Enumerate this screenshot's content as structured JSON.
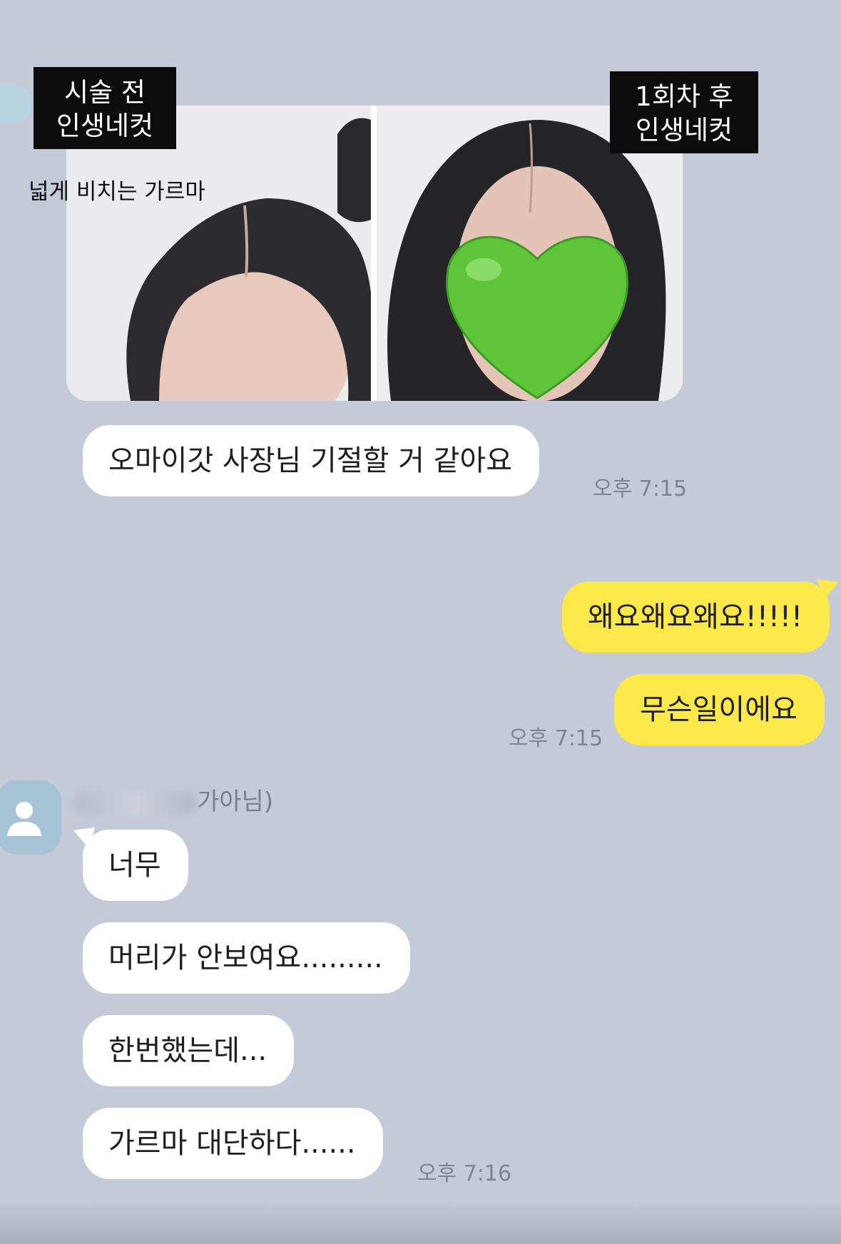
{
  "overlay": {
    "before_caption_line1": "시술 전",
    "before_caption_line2": "인생네컷",
    "after_caption_line1": "1회차 후",
    "after_caption_line2": "인생네컷",
    "parting_label": "넓게 비치는 가르마"
  },
  "photos": {
    "before_icon": "hair-photo-before",
    "after_icon": "hair-photo-after",
    "heart_icon": "green-heart-emoji",
    "heart_color": "#5ec53a"
  },
  "chat": {
    "bubble_colors": {
      "mine": "#fbe94a",
      "theirs": "#ffffff",
      "background": "#c5cad8"
    },
    "msg1": {
      "text": "오마이갓 사장님 기절할 거 같아요",
      "time": "오후 7:15"
    },
    "msg2": {
      "text": "왜요왜요왜요!!!!!"
    },
    "msg3": {
      "text": "무슨일이에요",
      "time": "오후 7:15"
    },
    "sender": {
      "name_suffix": "가아님)",
      "avatar_icon": "default-user-icon"
    },
    "msg4": {
      "text": "너무"
    },
    "msg5": {
      "text": "머리가 안보여요........."
    },
    "msg6": {
      "text": "한번했는데..."
    },
    "msg7": {
      "text": "가르마 대단하다......",
      "time": "오후 7:16"
    }
  }
}
